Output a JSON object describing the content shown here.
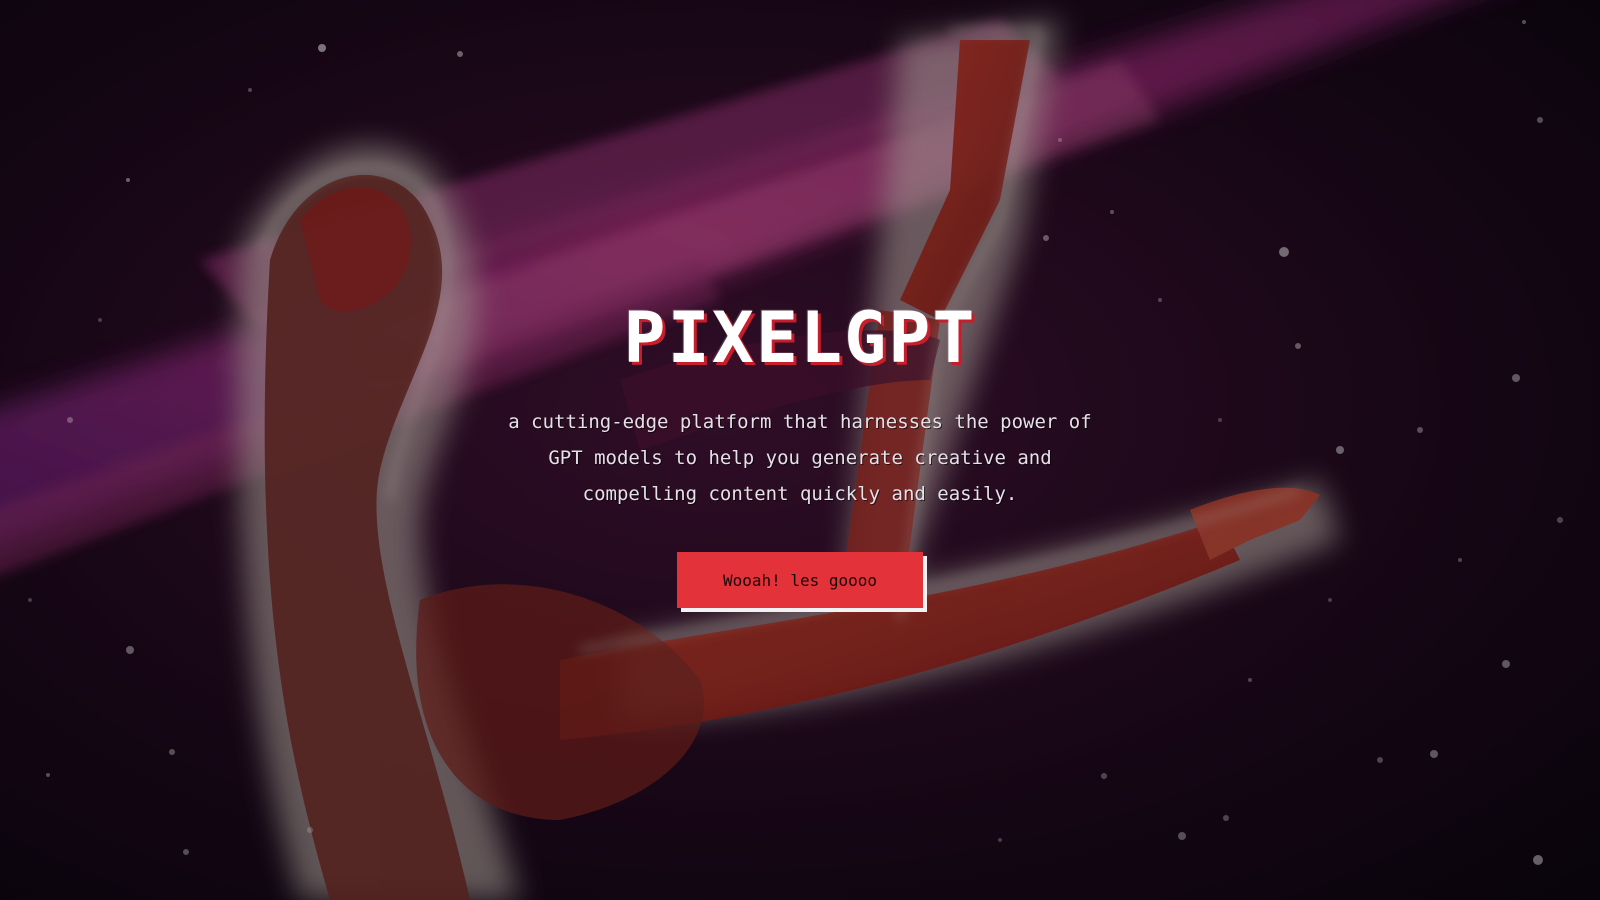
{
  "hero": {
    "title": "PIXELGPT",
    "description": "a cutting-edge platform that harnesses the power of GPT models to help you generate creative and compelling content quickly and easily.",
    "cta_label": "Wooah! les goooo"
  },
  "colors": {
    "accent": "#e3323a",
    "title_shadow": "#c81e2c",
    "text": "#e6e0e8",
    "background": "#050208"
  }
}
